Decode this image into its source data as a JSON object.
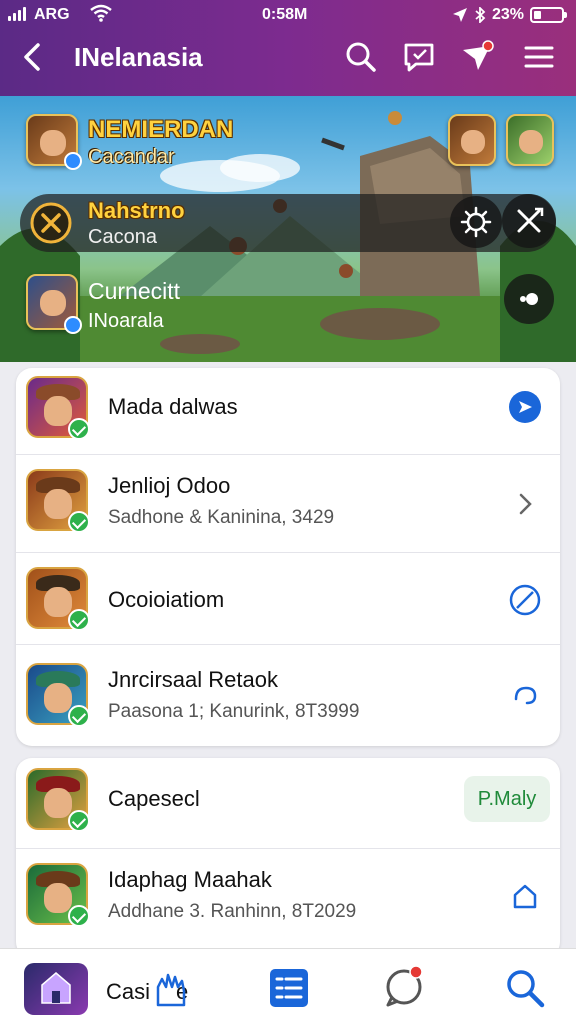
{
  "status_bar": {
    "carrier": "ARG",
    "time": "0:58M",
    "battery": "23%"
  },
  "header": {
    "title": "INelanasia"
  },
  "banner": {
    "title": "NEMIERDAN",
    "subtitle": "Cacandar",
    "row2_title": "Nahstrno",
    "row2_sub": "Cacona",
    "row3_title": "Curnecitt",
    "row3_sub": "INoarala"
  },
  "list1": [
    {
      "name": "Mada dalwas",
      "sub": ""
    },
    {
      "name": "Jenlioj Odoo",
      "sub": "Sadhone & Kaninina, 3429"
    },
    {
      "name": "Ocoioiatiom",
      "sub": ""
    },
    {
      "name": "Jnrcirsaal Retaok",
      "sub": "Paasona 1; Kanurink, 8T3999"
    }
  ],
  "list2": [
    {
      "name": "Capesecl",
      "sub": "",
      "pill": "P.Maly"
    },
    {
      "name": "Idaphag Maahak",
      "sub": "Addhane 3. Ranhinn, 8T2029"
    }
  ],
  "bottom_nav": {
    "label": "Casi",
    "label_suffix": "e"
  },
  "colors": {
    "header_start": "#5b2a86",
    "header_end": "#9a2f7c",
    "accent": "#1a66d9",
    "check": "#2eb14b"
  }
}
